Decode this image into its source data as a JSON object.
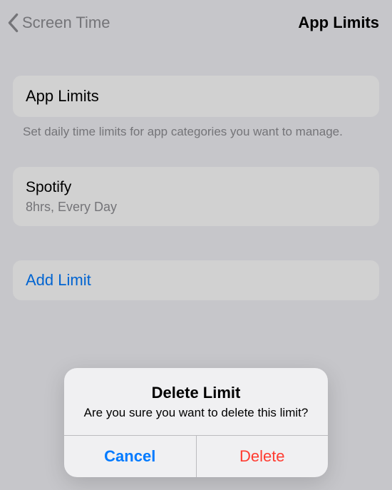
{
  "nav": {
    "back_label": "Screen Time",
    "title": "App Limits"
  },
  "sections": {
    "header_row_label": "App Limits",
    "header_footer": "Set daily time limits for app categories you want to manage.",
    "limit": {
      "app_name": "Spotify",
      "detail": "8hrs, Every Day"
    },
    "add_limit_label": "Add Limit"
  },
  "alert": {
    "title": "Delete Limit",
    "message": "Are you sure you want to delete this limit?",
    "cancel_label": "Cancel",
    "delete_label": "Delete"
  }
}
